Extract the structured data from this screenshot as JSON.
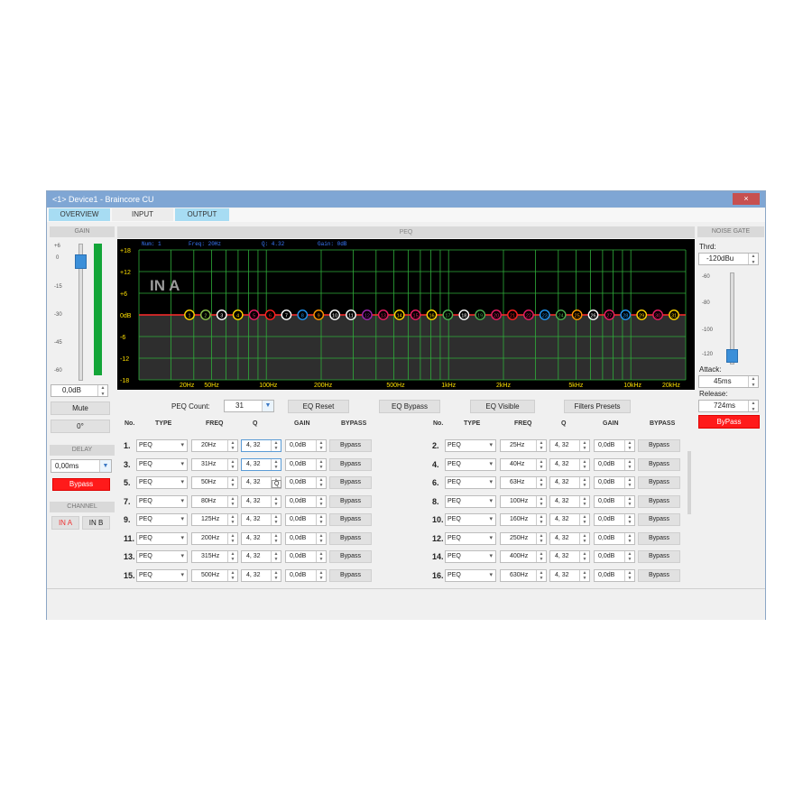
{
  "window": {
    "title": "<1> Device1 - Braincore CU",
    "close_label": "×"
  },
  "tabs": [
    {
      "label": "OVERVIEW",
      "active": true
    },
    {
      "label": "INPUT",
      "active": false
    },
    {
      "label": "OUTPUT",
      "active": true
    }
  ],
  "gain": {
    "header": "GAIN",
    "scale": [
      "+6",
      "0",
      "-15",
      "-30",
      "-45",
      "-60"
    ],
    "value": "0,0dB",
    "mute_label": "Mute",
    "phase_label": "0°"
  },
  "delay": {
    "header": "DELAY",
    "value": "0,00ms",
    "bypass_label": "Bypass"
  },
  "channel": {
    "header": "CHANNEL",
    "in_a": "IN A",
    "in_b": "IN B"
  },
  "peq": {
    "header": "PEQ",
    "readout": {
      "num": "Num:  1",
      "freq": "Freq:  20Hz",
      "q": "Q:  4.32",
      "gain": "Gain:  0dB"
    },
    "channel_label": "IN A",
    "y_ticks": [
      "+18",
      "+12",
      "+6",
      "0dB",
      "-6",
      "-12",
      "-18"
    ],
    "x_ticks": [
      "20Hz",
      "50Hz",
      "100Hz",
      "200Hz",
      "500Hz",
      "1kHz",
      "2kHz",
      "5kHz",
      "10kHz",
      "20kHz"
    ],
    "band_nodes": [
      "1",
      "2",
      "3",
      "4",
      "5",
      "6",
      "7",
      "8",
      "9",
      "10",
      "11",
      "12",
      "13",
      "14",
      "15",
      "16",
      "17",
      "18",
      "19",
      "20",
      "21",
      "22",
      "23",
      "24",
      "25",
      "26",
      "27",
      "28",
      "29",
      "30",
      "31"
    ],
    "node_colors": [
      "#ffd700",
      "#8bc34a",
      "#ffffff",
      "#ffd700",
      "#e91e63",
      "#ff2020",
      "#ffffff",
      "#2196f3",
      "#ff9800",
      "#ffffff",
      "#ffffff",
      "#9c27b0",
      "#e91e63",
      "#ffd700",
      "#e91e63",
      "#ffd700",
      "#4caf50",
      "#ffffff",
      "#4caf50",
      "#e91e63",
      "#ff2020",
      "#e91e63",
      "#2196f3",
      "#4caf50",
      "#ff9800",
      "#ffffff",
      "#e91e63",
      "#2196f3",
      "#ffd700",
      "#e91e63",
      "#ffd700"
    ],
    "count_label": "PEQ Count:",
    "count_value": "31",
    "eq_reset": "EQ Reset",
    "eq_bypass": "EQ Bypass",
    "eq_visible": "EQ Visible",
    "filters_presets": "Filters Presets",
    "columns": [
      "No.",
      "TYPE",
      "FREQ",
      "Q",
      "GAIN",
      "BYPASS"
    ],
    "left_rows": [
      {
        "no": "1.",
        "type": "PEQ",
        "freq": "20Hz",
        "q": "4, 32",
        "gain": "0,0dB",
        "bypass": "Bypass"
      },
      {
        "no": "3.",
        "type": "PEQ",
        "freq": "31Hz",
        "q": "4, 32",
        "gain": "0,0dB",
        "bypass": "Bypass"
      },
      {
        "no": "5.",
        "type": "PEQ",
        "freq": "50Hz",
        "q": "4, 32",
        "gain": "0,0dB",
        "bypass": "Bypass"
      },
      {
        "no": "7.",
        "type": "PEQ",
        "freq": "80Hz",
        "q": "4, 32",
        "gain": "0,0dB",
        "bypass": "Bypass"
      },
      {
        "no": "9.",
        "type": "PEQ",
        "freq": "125Hz",
        "q": "4, 32",
        "gain": "0,0dB",
        "bypass": "Bypass"
      },
      {
        "no": "11.",
        "type": "PEQ",
        "freq": "200Hz",
        "q": "4, 32",
        "gain": "0,0dB",
        "bypass": "Bypass"
      },
      {
        "no": "13.",
        "type": "PEQ",
        "freq": "315Hz",
        "q": "4, 32",
        "gain": "0,0dB",
        "bypass": "Bypass"
      },
      {
        "no": "15.",
        "type": "PEQ",
        "freq": "500Hz",
        "q": "4, 32",
        "gain": "0,0dB",
        "bypass": "Bypass"
      }
    ],
    "right_rows": [
      {
        "no": "2.",
        "type": "PEQ",
        "freq": "25Hz",
        "q": "4, 32",
        "gain": "0,0dB",
        "bypass": "Bypass"
      },
      {
        "no": "4.",
        "type": "PEQ",
        "freq": "40Hz",
        "q": "4, 32",
        "gain": "0,0dB",
        "bypass": "Bypass"
      },
      {
        "no": "6.",
        "type": "PEQ",
        "freq": "63Hz",
        "q": "4, 32",
        "gain": "0,0dB",
        "bypass": "Bypass"
      },
      {
        "no": "8.",
        "type": "PEQ",
        "freq": "100Hz",
        "q": "4, 32",
        "gain": "0,0dB",
        "bypass": "Bypass"
      },
      {
        "no": "10.",
        "type": "PEQ",
        "freq": "160Hz",
        "q": "4, 32",
        "gain": "0,0dB",
        "bypass": "Bypass"
      },
      {
        "no": "12.",
        "type": "PEQ",
        "freq": "250Hz",
        "q": "4, 32",
        "gain": "0,0dB",
        "bypass": "Bypass"
      },
      {
        "no": "14.",
        "type": "PEQ",
        "freq": "400Hz",
        "q": "4, 32",
        "gain": "0,0dB",
        "bypass": "Bypass"
      },
      {
        "no": "16.",
        "type": "PEQ",
        "freq": "630Hz",
        "q": "4, 32",
        "gain": "0,0dB",
        "bypass": "Bypass"
      }
    ],
    "tooltip": "Q"
  },
  "noise_gate": {
    "header": "NOISE GATE",
    "thrd_label": "Thrd:",
    "thrd_value": "-120dBu",
    "scale": [
      "-60",
      "-80",
      "-100",
      "-120"
    ],
    "attack_label": "Attack:",
    "attack_value": "45ms",
    "release_label": "Release:",
    "release_value": "724ms",
    "bypass_label": "ByPass"
  },
  "colors": {
    "accent": "#a7dcf3",
    "bypass_red": "#ff1a1a",
    "title_blue": "#7fa6d4",
    "level_green": "#13a538"
  }
}
